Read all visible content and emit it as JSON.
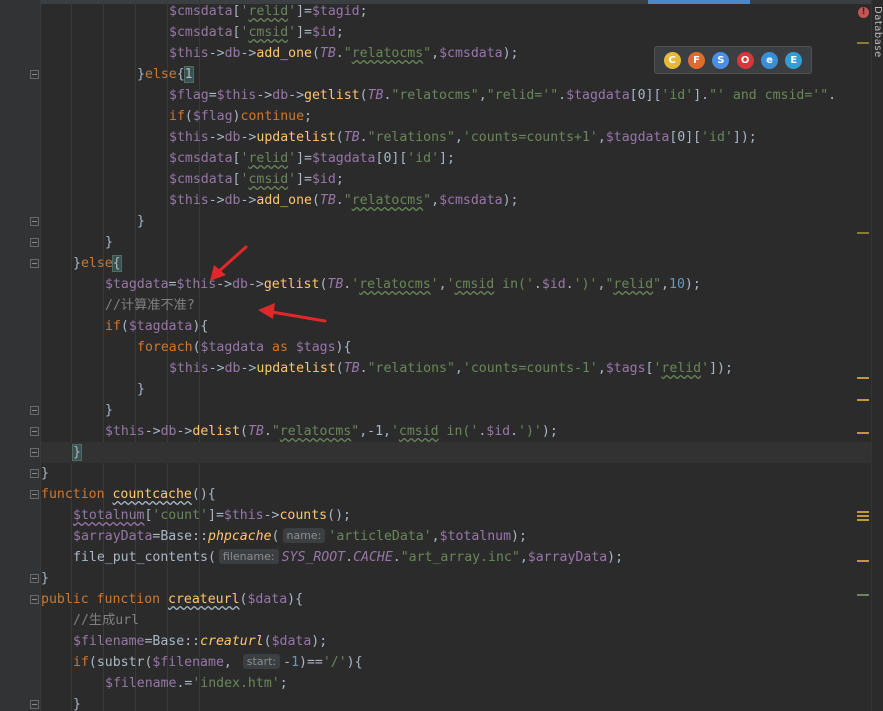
{
  "sidebar": {
    "database_label": "Database"
  },
  "browsers": [
    {
      "name": "Chrome",
      "icon": "chrome-icon",
      "color": "#e8b838",
      "glyph": "C"
    },
    {
      "name": "Firefox",
      "icon": "firefox-icon",
      "color": "#e06b2c",
      "glyph": "F"
    },
    {
      "name": "Safari",
      "icon": "safari-icon",
      "color": "#4a8ee8",
      "glyph": "S"
    },
    {
      "name": "Opera",
      "icon": "opera-icon",
      "color": "#d8363a",
      "glyph": "O"
    },
    {
      "name": "Internet Explorer",
      "icon": "ie-icon",
      "color": "#3a8ed8",
      "glyph": "e"
    },
    {
      "name": "Edge",
      "icon": "edge-icon",
      "color": "#2f9fd6",
      "glyph": "E"
    }
  ],
  "colors": {
    "background": "#2b2b2b",
    "keyword": "#cc7832",
    "variable": "#9876aa",
    "function": "#ffc66d",
    "string": "#6a8759",
    "number": "#6897bb",
    "comment": "#808080",
    "annotation_arrow": "#e0282a"
  },
  "code_lines": [
    {
      "indent": 5,
      "tokens": [
        [
          "var",
          "$cmsdata"
        ],
        [
          "op",
          "["
        ],
        [
          "str",
          "'"
        ],
        [
          "sq",
          "relid"
        ],
        [
          "str",
          "'"
        ],
        [
          "op",
          "]="
        ],
        [
          "var",
          "$tagid"
        ],
        [
          "op",
          ";"
        ]
      ]
    },
    {
      "indent": 5,
      "tokens": [
        [
          "var",
          "$cmsdata"
        ],
        [
          "op",
          "["
        ],
        [
          "str",
          "'"
        ],
        [
          "sq",
          "cmsid"
        ],
        [
          "str",
          "'"
        ],
        [
          "op",
          "]="
        ],
        [
          "var",
          "$id"
        ],
        [
          "op",
          ";"
        ]
      ]
    },
    {
      "indent": 5,
      "tokens": [
        [
          "var",
          "$this"
        ],
        [
          "op",
          "->"
        ],
        [
          "var",
          "db"
        ],
        [
          "op",
          "->"
        ],
        [
          "fn",
          "add_one"
        ],
        [
          "op",
          "("
        ],
        [
          "const",
          "TB"
        ],
        [
          "op",
          "."
        ],
        [
          "str",
          "\""
        ],
        [
          "sq",
          "relatocms"
        ],
        [
          "str",
          "\""
        ],
        [
          "op",
          ","
        ],
        [
          "var",
          "$cmsdata"
        ],
        [
          "op",
          ");"
        ]
      ]
    },
    {
      "indent": 4,
      "tokens": [
        [
          "op",
          "}"
        ],
        [
          "kw",
          "else"
        ],
        [
          "op",
          "{"
        ],
        [
          "brace",
          "1"
        ]
      ]
    },
    {
      "indent": 5,
      "tokens": [
        [
          "var",
          "$flag"
        ],
        [
          "op",
          "="
        ],
        [
          "var",
          "$this"
        ],
        [
          "op",
          "->"
        ],
        [
          "var",
          "db"
        ],
        [
          "op",
          "->"
        ],
        [
          "fn",
          "getlist"
        ],
        [
          "op",
          "("
        ],
        [
          "const",
          "TB"
        ],
        [
          "op",
          "."
        ],
        [
          "str",
          "\"relatocms\""
        ],
        [
          "op",
          ","
        ],
        [
          "str",
          "\"relid='\""
        ],
        [
          "op",
          "."
        ],
        [
          "var",
          "$tagdata"
        ],
        [
          "op",
          "[0]["
        ],
        [
          "str",
          "'id'"
        ],
        [
          "op",
          "]."
        ],
        [
          "str",
          "\"' and cmsid='\""
        ],
        [
          "op",
          "."
        ]
      ]
    },
    {
      "indent": 5,
      "tokens": [
        [
          "kw",
          "if"
        ],
        [
          "op",
          "("
        ],
        [
          "var",
          "$flag"
        ],
        [
          "op",
          ")"
        ],
        [
          "kw",
          "continue"
        ],
        [
          "op",
          ";"
        ]
      ]
    },
    {
      "indent": 5,
      "tokens": [
        [
          "var",
          "$this"
        ],
        [
          "op",
          "->"
        ],
        [
          "var",
          "db"
        ],
        [
          "op",
          "->"
        ],
        [
          "fn",
          "updatelist"
        ],
        [
          "op",
          "("
        ],
        [
          "const",
          "TB"
        ],
        [
          "op",
          "."
        ],
        [
          "str",
          "\"relations\""
        ],
        [
          "op",
          ","
        ],
        [
          "str",
          "'counts=counts+1'"
        ],
        [
          "op",
          ","
        ],
        [
          "var",
          "$tagdata"
        ],
        [
          "op",
          "[0]["
        ],
        [
          "str",
          "'id'"
        ],
        [
          "op",
          "]);"
        ]
      ]
    },
    {
      "indent": 5,
      "tokens": [
        [
          "var",
          "$cmsdata"
        ],
        [
          "op",
          "["
        ],
        [
          "str",
          "'"
        ],
        [
          "sq",
          "relid"
        ],
        [
          "str",
          "'"
        ],
        [
          "op",
          "]="
        ],
        [
          "var",
          "$tagdata"
        ],
        [
          "op",
          "[0]["
        ],
        [
          "str",
          "'id'"
        ],
        [
          "op",
          "];"
        ]
      ]
    },
    {
      "indent": 5,
      "tokens": [
        [
          "var",
          "$cmsdata"
        ],
        [
          "op",
          "["
        ],
        [
          "str",
          "'"
        ],
        [
          "sq",
          "cmsid"
        ],
        [
          "str",
          "'"
        ],
        [
          "op",
          "]="
        ],
        [
          "var",
          "$id"
        ],
        [
          "op",
          ";"
        ]
      ]
    },
    {
      "indent": 5,
      "tokens": [
        [
          "var",
          "$this"
        ],
        [
          "op",
          "->"
        ],
        [
          "var",
          "db"
        ],
        [
          "op",
          "->"
        ],
        [
          "fn",
          "add_one"
        ],
        [
          "op",
          "("
        ],
        [
          "const",
          "TB"
        ],
        [
          "op",
          "."
        ],
        [
          "str",
          "\""
        ],
        [
          "sq",
          "relatocms"
        ],
        [
          "str",
          "\""
        ],
        [
          "op",
          ","
        ],
        [
          "var",
          "$cmsdata"
        ],
        [
          "op",
          ");"
        ]
      ]
    },
    {
      "indent": 4,
      "tokens": [
        [
          "op",
          "}"
        ]
      ]
    },
    {
      "indent": 3,
      "tokens": [
        [
          "op",
          "}"
        ]
      ]
    },
    {
      "indent": 2,
      "tokens": [
        [
          "op",
          "}"
        ],
        [
          "kw",
          "else"
        ],
        [
          "brace",
          "{"
        ]
      ]
    },
    {
      "indent": 3,
      "tokens": [
        [
          "var",
          "$tagdata"
        ],
        [
          "op",
          "="
        ],
        [
          "var",
          "$this"
        ],
        [
          "op",
          "->"
        ],
        [
          "var",
          "db"
        ],
        [
          "op",
          "->"
        ],
        [
          "fn",
          "getlist"
        ],
        [
          "op",
          "("
        ],
        [
          "const",
          "TB"
        ],
        [
          "op",
          "."
        ],
        [
          "str",
          "'"
        ],
        [
          "sq",
          "relatocms"
        ],
        [
          "str",
          "'"
        ],
        [
          "op",
          ","
        ],
        [
          "str",
          "'"
        ],
        [
          "sq",
          "cmsid"
        ],
        [
          "str",
          " in('"
        ],
        [
          "op",
          "."
        ],
        [
          "var",
          "$id"
        ],
        [
          "op",
          "."
        ],
        [
          "str",
          "')'"
        ],
        [
          "op",
          ","
        ],
        [
          "str",
          "\""
        ],
        [
          "sq",
          "relid"
        ],
        [
          "str",
          "\""
        ],
        [
          "op",
          ","
        ],
        [
          "num",
          "10"
        ],
        [
          "op",
          ");"
        ]
      ]
    },
    {
      "indent": 3,
      "tokens": [
        [
          "com",
          "//计算准不准?"
        ]
      ]
    },
    {
      "indent": 3,
      "tokens": [
        [
          "kw",
          "if"
        ],
        [
          "op",
          "("
        ],
        [
          "var",
          "$tagdata"
        ],
        [
          "op",
          "){"
        ]
      ]
    },
    {
      "indent": 4,
      "tokens": [
        [
          "kw",
          "foreach"
        ],
        [
          "op",
          "("
        ],
        [
          "var",
          "$tagdata"
        ],
        [
          "kw",
          " as "
        ],
        [
          "var",
          "$tags"
        ],
        [
          "op",
          "){"
        ]
      ]
    },
    {
      "indent": 5,
      "tokens": [
        [
          "var",
          "$this"
        ],
        [
          "op",
          "->"
        ],
        [
          "var",
          "db"
        ],
        [
          "op",
          "->"
        ],
        [
          "fn",
          "updatelist"
        ],
        [
          "op",
          "("
        ],
        [
          "const",
          "TB"
        ],
        [
          "op",
          "."
        ],
        [
          "str",
          "\"relations\""
        ],
        [
          "op",
          ","
        ],
        [
          "str",
          "'counts=counts-1'"
        ],
        [
          "op",
          ","
        ],
        [
          "var",
          "$tags"
        ],
        [
          "op",
          "["
        ],
        [
          "str",
          "'"
        ],
        [
          "sq",
          "relid"
        ],
        [
          "str",
          "'"
        ],
        [
          "op",
          "]);"
        ]
      ]
    },
    {
      "indent": 4,
      "tokens": [
        [
          "op",
          "}"
        ]
      ]
    },
    {
      "indent": 3,
      "tokens": [
        [
          "op",
          "}"
        ]
      ]
    },
    {
      "indent": 3,
      "tokens": [
        [
          "var",
          "$this"
        ],
        [
          "op",
          "->"
        ],
        [
          "var",
          "db"
        ],
        [
          "op",
          "->"
        ],
        [
          "fn",
          "delist"
        ],
        [
          "op",
          "("
        ],
        [
          "const",
          "TB"
        ],
        [
          "op",
          "."
        ],
        [
          "str",
          "\""
        ],
        [
          "sq",
          "relatocms"
        ],
        [
          "str",
          "\""
        ],
        [
          "op",
          ",-1,"
        ],
        [
          "str",
          "'"
        ],
        [
          "sq",
          "cmsid"
        ],
        [
          "str",
          " in('"
        ],
        [
          "op",
          "."
        ],
        [
          "var",
          "$id"
        ],
        [
          "op",
          "."
        ],
        [
          "str",
          "')'"
        ],
        [
          "op",
          ");"
        ]
      ]
    },
    {
      "indent": 2,
      "current": true,
      "tokens": [
        [
          "brace",
          "}"
        ]
      ]
    },
    {
      "indent": 1,
      "tokens": [
        [
          "op",
          "}"
        ]
      ]
    },
    {
      "indent": 1,
      "tokens": [
        [
          "kw",
          "function "
        ],
        [
          "fnu",
          "countcache"
        ],
        [
          "op",
          "(){"
        ]
      ]
    },
    {
      "indent": 2,
      "tokens": [
        [
          "varu",
          "$totalnum"
        ],
        [
          "op",
          "["
        ],
        [
          "str",
          "'count'"
        ],
        [
          "op",
          "]="
        ],
        [
          "var",
          "$this"
        ],
        [
          "op",
          "->"
        ],
        [
          "fn",
          "counts"
        ],
        [
          "op",
          "();"
        ]
      ]
    },
    {
      "indent": 2,
      "tokens": [
        [
          "var",
          "$arrayData"
        ],
        [
          "op",
          "="
        ],
        [
          "cls",
          "Base"
        ],
        [
          "op",
          "::"
        ],
        [
          "static",
          "phpcache"
        ],
        [
          "op",
          "("
        ],
        [
          "hint",
          "name:"
        ],
        [
          "str",
          "'articleData'"
        ],
        [
          "op",
          ","
        ],
        [
          "var",
          "$totalnum"
        ],
        [
          "op",
          ");"
        ]
      ]
    },
    {
      "indent": 2,
      "tokens": [
        [
          "op",
          "file_put_contents("
        ],
        [
          "hint",
          "filename:"
        ],
        [
          "const",
          "SYS_ROOT"
        ],
        [
          "op",
          "."
        ],
        [
          "const",
          "CACHE"
        ],
        [
          "op",
          "."
        ],
        [
          "str",
          "\"art_array.inc\""
        ],
        [
          "op",
          ","
        ],
        [
          "var",
          "$arrayData"
        ],
        [
          "op",
          ");"
        ]
      ]
    },
    {
      "indent": 1,
      "tokens": [
        [
          "op",
          "}"
        ]
      ]
    },
    {
      "indent": 1,
      "tokens": [
        [
          "kw",
          "public function "
        ],
        [
          "fnu",
          "createurl"
        ],
        [
          "op",
          "("
        ],
        [
          "var",
          "$data"
        ],
        [
          "op",
          "){"
        ]
      ]
    },
    {
      "indent": 2,
      "tokens": [
        [
          "com",
          "//生成url"
        ]
      ]
    },
    {
      "indent": 2,
      "tokens": [
        [
          "var",
          "$filename"
        ],
        [
          "op",
          "="
        ],
        [
          "cls",
          "Base"
        ],
        [
          "op",
          "::"
        ],
        [
          "static",
          "creaturl"
        ],
        [
          "op",
          "("
        ],
        [
          "var",
          "$data"
        ],
        [
          "op",
          ");"
        ]
      ]
    },
    {
      "indent": 2,
      "tokens": [
        [
          "kw",
          "if"
        ],
        [
          "op",
          "(substr("
        ],
        [
          "var",
          "$filename"
        ],
        [
          "op",
          ", "
        ],
        [
          "hint",
          "start:"
        ],
        [
          "op",
          "-"
        ],
        [
          "num",
          "1"
        ],
        [
          "op",
          ")=="
        ],
        [
          "str",
          "'/'"
        ],
        [
          "op",
          "){"
        ]
      ]
    },
    {
      "indent": 3,
      "tokens": [
        [
          "var",
          "$filename"
        ],
        [
          "op",
          ".="
        ],
        [
          "str",
          "'index.htm'"
        ],
        [
          "op",
          ";"
        ]
      ]
    },
    {
      "indent": 2,
      "tokens": [
        [
          "op",
          "}"
        ]
      ]
    }
  ]
}
